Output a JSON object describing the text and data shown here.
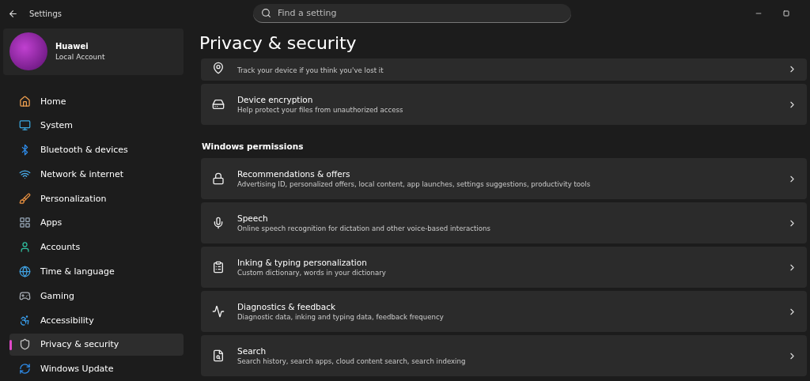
{
  "window": {
    "title": "Settings"
  },
  "search": {
    "placeholder": "Find a setting"
  },
  "account": {
    "name": "Huawei",
    "type": "Local Account"
  },
  "sidebar": {
    "items": [
      {
        "label": "Home",
        "kind": "home",
        "selected": false
      },
      {
        "label": "System",
        "kind": "system",
        "selected": false
      },
      {
        "label": "Bluetooth & devices",
        "kind": "bluetooth",
        "selected": false
      },
      {
        "label": "Network & internet",
        "kind": "network",
        "selected": false
      },
      {
        "label": "Personalization",
        "kind": "brush",
        "selected": false
      },
      {
        "label": "Apps",
        "kind": "apps",
        "selected": false
      },
      {
        "label": "Accounts",
        "kind": "accounts",
        "selected": false
      },
      {
        "label": "Time & language",
        "kind": "time",
        "selected": false
      },
      {
        "label": "Gaming",
        "kind": "gaming",
        "selected": false
      },
      {
        "label": "Accessibility",
        "kind": "accessibility",
        "selected": false
      },
      {
        "label": "Privacy & security",
        "kind": "privacy",
        "selected": true
      },
      {
        "label": "Windows Update",
        "kind": "update",
        "selected": false
      }
    ]
  },
  "page": {
    "title": "Privacy & security",
    "sections": [
      {
        "items": [
          {
            "kind": "locate",
            "description": "Track your device if you think you've lost it",
            "clipped": true
          },
          {
            "kind": "encryption",
            "title": "Device encryption",
            "description": "Help protect your files from unauthorized access"
          }
        ]
      },
      {
        "heading": "Windows permissions",
        "items": [
          {
            "kind": "lock",
            "title": "Recommendations & offers",
            "description": "Advertising ID, personalized offers, local content, app launches, settings suggestions, productivity tools"
          },
          {
            "kind": "speech",
            "title": "Speech",
            "description": "Online speech recognition for dictation and other voice-based interactions"
          },
          {
            "kind": "inking",
            "title": "Inking & typing personalization",
            "description": "Custom dictionary, words in your dictionary"
          },
          {
            "kind": "diagnostics",
            "title": "Diagnostics & feedback",
            "description": "Diagnostic data, inking and typing data, feedback frequency"
          },
          {
            "kind": "search",
            "title": "Search",
            "description": "Search history, search apps, cloud content search, search indexing"
          }
        ]
      }
    ]
  }
}
